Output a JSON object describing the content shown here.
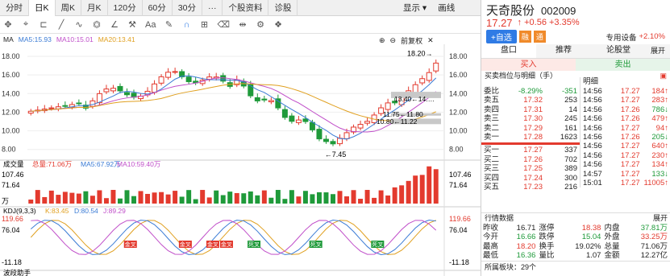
{
  "period_tabs": [
    "分时",
    "日K",
    "周K",
    "月K",
    "120分",
    "60分",
    "30分",
    "···",
    "个股资料",
    "诊股"
  ],
  "active_tab": "日K",
  "display_menu": "显示 ▾",
  "draw_button": "画线",
  "toolbar_icons": [
    "move-icon",
    "crosshair-icon",
    "rect-icon",
    "line-icon",
    "wave-icon",
    "fib-icon",
    "angle-icon",
    "hammer-icon",
    "text-icon",
    "eraser-icon",
    "magnet-icon",
    "lock-icon",
    "trash-icon",
    "measure-icon",
    "settings-icon",
    "layers-icon"
  ],
  "main_chart": {
    "label": "MA",
    "ma5": "MA5:15.93",
    "ma10": "MA10:15.01",
    "ma20": "MA20:13.41",
    "adjust": "前复权",
    "y_ticks": [
      "18.00",
      "16.00",
      "14.00",
      "12.00",
      "10.00",
      "8.00"
    ],
    "annotations": {
      "high": "18.20→",
      "low": "←7.45",
      "range1": "13.40←14.…",
      "range2": "11.75←11.80",
      "range3": "10.80←11.22"
    },
    "colors": {
      "up": "#e33a2e",
      "down": "#1f9a3a",
      "ma5": "#3a7bd5",
      "ma10": "#c04ec9",
      "ma20": "#e0a020"
    }
  },
  "volume": {
    "label": "成交量",
    "total": "总量:71.06万",
    "ma5": "MA5:67.92万",
    "ma10": "MA10:59.40万",
    "y_ticks": [
      "107.46",
      "71.64",
      "万"
    ]
  },
  "kdj": {
    "label": "KDJ(9,3,3)",
    "k": "K:83.45",
    "d": "D:80.54",
    "j": "J:89.29",
    "y_ticks": [
      "119.66",
      "76.04",
      "-11.18"
    ],
    "golden": "金叉",
    "dead": "死叉"
  },
  "wave": {
    "label": "波段助手"
  },
  "quote": {
    "name": "天奇股份",
    "code": "002009",
    "price": "17.27",
    "change": "↑ +0.56 +3.35%",
    "add_button": "+自选",
    "badge1": "融",
    "badge2": "通",
    "device": "专用设备",
    "device_pct": "+2.10%"
  },
  "right_tabs": [
    "盘口",
    "推荐",
    "论股堂"
  ],
  "expand": "展开",
  "buysell": {
    "buy": "买入",
    "sell": "卖出"
  },
  "book_title": "买卖档位与明细（手）",
  "detail_title": "明细",
  "ratio": {
    "label": "委比",
    "pct": "-8.29%",
    "val": "-351"
  },
  "asks": [
    {
      "n": "卖五",
      "p": "17.32",
      "v": "253"
    },
    {
      "n": "卖四",
      "p": "17.31",
      "v": "14"
    },
    {
      "n": "卖三",
      "p": "17.30",
      "v": "245"
    },
    {
      "n": "卖二",
      "p": "17.29",
      "v": "161"
    },
    {
      "n": "卖一",
      "p": "17.28",
      "v": "1623"
    }
  ],
  "bids": [
    {
      "n": "买一",
      "p": "17.27",
      "v": "337"
    },
    {
      "n": "买二",
      "p": "17.26",
      "v": "702"
    },
    {
      "n": "买三",
      "p": "17.25",
      "v": "389"
    },
    {
      "n": "买四",
      "p": "17.24",
      "v": "300"
    },
    {
      "n": "买五",
      "p": "17.23",
      "v": "216"
    }
  ],
  "ticks": [
    {
      "t": "14:56",
      "p": "17.27",
      "v": "184↑",
      "c": "red"
    },
    {
      "t": "14:56",
      "p": "17.27",
      "v": "283↑",
      "c": "red"
    },
    {
      "t": "14:56",
      "p": "17.26",
      "v": "786↓",
      "c": "green"
    },
    {
      "t": "14:56",
      "p": "17.26",
      "v": "479↑",
      "c": "red"
    },
    {
      "t": "14:56",
      "p": "17.27",
      "v": "94↑",
      "c": "red"
    },
    {
      "t": "14:56",
      "p": "17.26",
      "v": "205↓",
      "c": "green"
    },
    {
      "t": "14:56",
      "p": "17.27",
      "v": "640↑",
      "c": "red"
    },
    {
      "t": "14:56",
      "p": "17.27",
      "v": "230↑",
      "c": "red"
    },
    {
      "t": "14:56",
      "p": "17.27",
      "v": "134↑",
      "c": "red"
    },
    {
      "t": "14:57",
      "p": "17.27",
      "v": "133↓",
      "c": "green"
    },
    {
      "t": "15:01",
      "p": "17.27",
      "v": "11005↑",
      "c": "red"
    }
  ],
  "market_title": "行情数据",
  "market": [
    [
      "昨收",
      "16.71",
      "涨停",
      "18.38",
      "内盘",
      "37.81万"
    ],
    [
      "今开",
      "16.66",
      "跌停",
      "15.04",
      "外盘",
      "33.25万"
    ],
    [
      "最高",
      "18.20",
      "换手",
      "19.02%",
      "总量",
      "71.06万"
    ],
    [
      "最低",
      "16.36",
      "量比",
      "1.07",
      "金额",
      "12.27亿"
    ]
  ],
  "sector": "所属板块：29个"
}
